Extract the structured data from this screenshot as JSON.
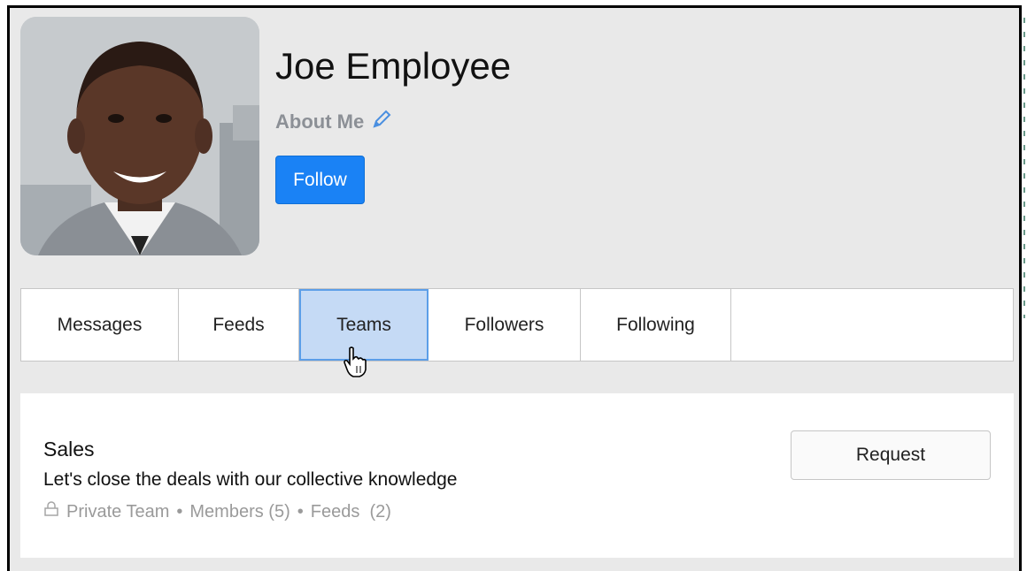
{
  "profile": {
    "name": "Joe Employee",
    "about_label": "About Me",
    "follow_label": "Follow"
  },
  "tabs": [
    {
      "label": "Messages",
      "active": false
    },
    {
      "label": "Feeds",
      "active": false
    },
    {
      "label": "Teams",
      "active": true
    },
    {
      "label": "Followers",
      "active": false
    },
    {
      "label": "Following",
      "active": false
    }
  ],
  "team": {
    "name": "Sales",
    "description": "Let's close the deals with our collective knowledge",
    "privacy": "Private Team",
    "members": "Members (5)",
    "feeds": "Feeds  (2)",
    "request_label": "Request"
  },
  "icons": [
    "pencil-icon",
    "lock-icon",
    "hand-pointer-icon"
  ],
  "colors": {
    "accent": "#1a82f5",
    "active_tab": "#c5daf5",
    "background": "#e9e9e9"
  }
}
